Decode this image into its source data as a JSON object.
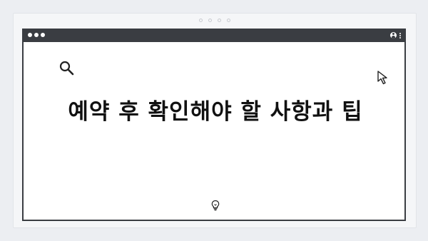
{
  "headline": "예약 후 확인해야 할 사항과 팁",
  "icons": {
    "search": "search-icon",
    "cursor": "cursor-arrow-icon",
    "lightbulb": "lightbulb-icon",
    "user": "user-icon",
    "menu": "kebab-menu-icon"
  },
  "colors": {
    "background": "#eceef2",
    "frame": "#f5f6f8",
    "browser_bar": "#3a3d42",
    "content_background": "#ffffff",
    "text": "#111111"
  }
}
